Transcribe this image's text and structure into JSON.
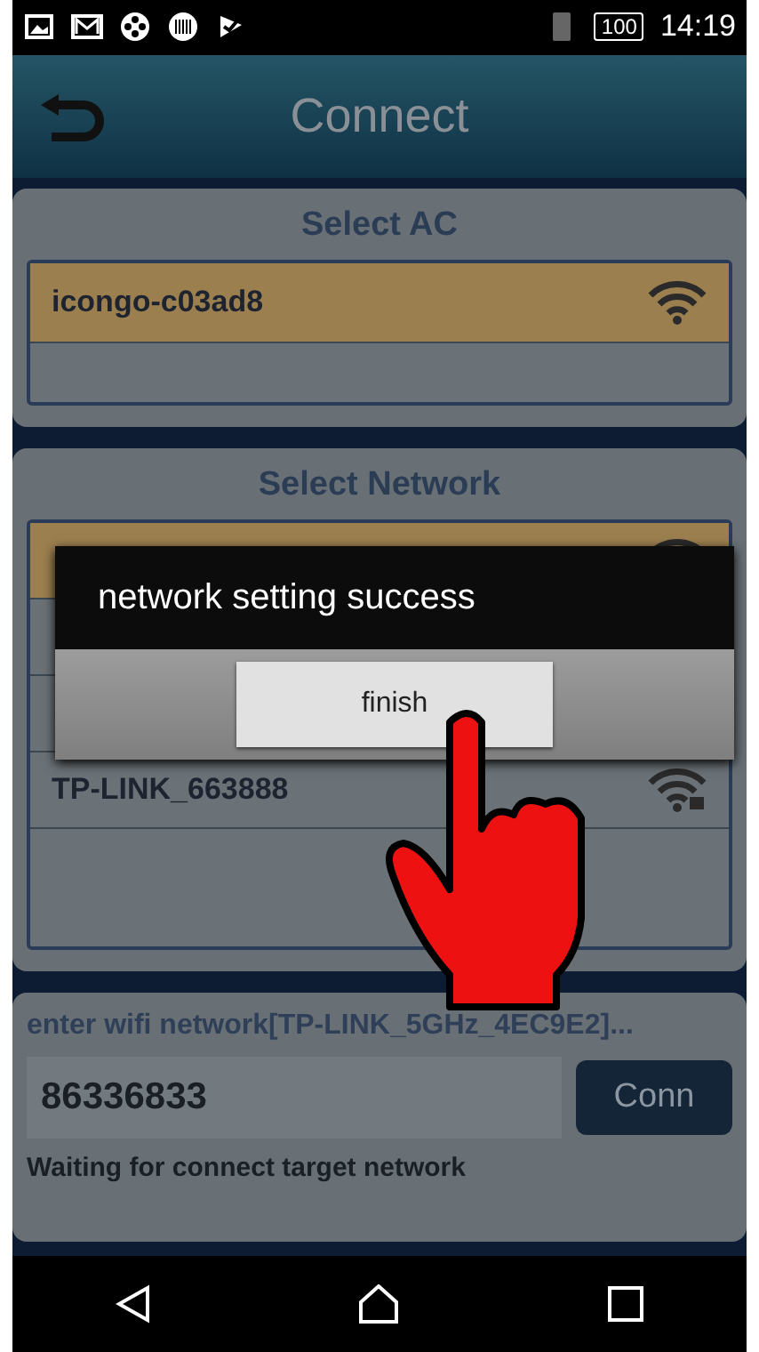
{
  "status_bar": {
    "battery": "100",
    "time": "14:19"
  },
  "header": {
    "title": "Connect"
  },
  "ac_panel": {
    "title": "Select AC",
    "items": [
      {
        "label": "icongo-c03ad8",
        "selected": true
      }
    ]
  },
  "network_panel": {
    "title": "Select Network",
    "items": [
      {
        "selected": true
      },
      {
        "selected": false
      },
      {
        "selected": false
      },
      {
        "label": "TP-LINK_663888",
        "selected": false,
        "secured": true
      }
    ]
  },
  "password_panel": {
    "label": "enter wifi network[TP-LINK_5GHz_4EC9E2]...",
    "value": "86336833",
    "button": "Conn",
    "status": "Waiting for connect target network"
  },
  "dialog": {
    "message": "network setting success",
    "button": "finish"
  }
}
